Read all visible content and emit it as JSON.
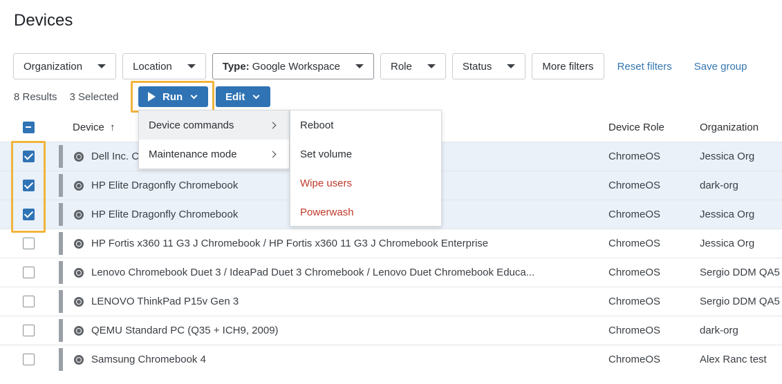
{
  "page": {
    "title": "Devices"
  },
  "filters": {
    "organization": "Organization",
    "location": "Location",
    "type_label": "Type:",
    "type_value": "Google Workspace",
    "role": "Role",
    "status": "Status",
    "more": "More filters",
    "reset": "Reset filters",
    "save_group": "Save group"
  },
  "results": {
    "count": "8 Results",
    "selected": "3 Selected"
  },
  "actions": {
    "run": "Run",
    "edit": "Edit"
  },
  "table": {
    "headers": {
      "device": "Device",
      "sort": "↑",
      "role": "Device Role",
      "org": "Organization"
    },
    "rows": [
      {
        "name": "Dell Inc. C",
        "role": "ChromeOS",
        "org": "Jessica Org"
      },
      {
        "name": "HP Elite Dragonfly Chromebook",
        "role": "ChromeOS",
        "org": "dark-org"
      },
      {
        "name": "HP Elite Dragonfly Chromebook",
        "role": "ChromeOS",
        "org": "Jessica Org"
      },
      {
        "name": "HP Fortis x360 11 G3 J Chromebook / HP Fortis x360 11 G3 J Chromebook Enterprise",
        "role": "ChromeOS",
        "org": "Jessica Org"
      },
      {
        "name": "Lenovo Chromebook Duet 3 / IdeaPad Duet 3 Chromebook / Lenovo Duet Chromebook Educa...",
        "role": "ChromeOS",
        "org": "Sergio DDM QA5"
      },
      {
        "name": "LENOVO ThinkPad P15v Gen 3",
        "role": "ChromeOS",
        "org": "Sergio DDM QA5"
      },
      {
        "name": "QEMU Standard PC (Q35 + ICH9, 2009)",
        "role": "ChromeOS",
        "org": "dark-org"
      },
      {
        "name": "Samsung Chromebook 4",
        "role": "ChromeOS",
        "org": "Alex Ranc test"
      }
    ]
  },
  "run_menu": {
    "items": [
      "Device commands",
      "Maintenance mode"
    ]
  },
  "device_commands_menu": {
    "items": [
      "Reboot",
      "Set volume",
      "Wipe users",
      "Powerwash"
    ]
  },
  "colors": {
    "accent": "#2f73b5",
    "highlight": "#f0b43c",
    "danger": "#c0392b",
    "link": "#3376b0"
  }
}
